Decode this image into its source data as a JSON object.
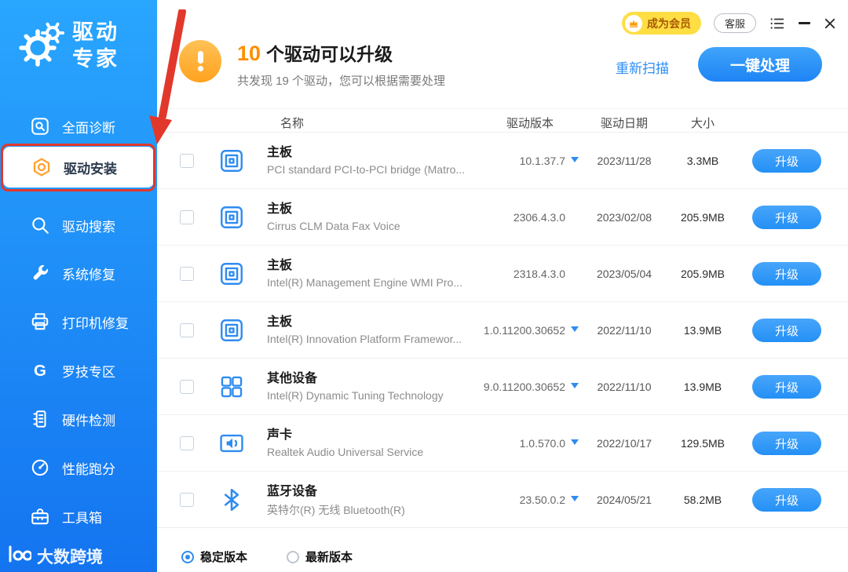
{
  "colors": {
    "accent_blue": "#2D9BF7",
    "sidebar_gradient_top": "#29A6FE",
    "sidebar_gradient_bottom": "#1474F0",
    "annotation_red": "#E2382C",
    "warning_orange": "#FFA21E",
    "member_yellow": "#FFDE43"
  },
  "window": {
    "member_label": "成为会员",
    "support_label": "客服"
  },
  "sidebar": {
    "logo_line1": "驱动",
    "logo_line2": "专家",
    "items": [
      {
        "label": "全面诊断",
        "active": false
      },
      {
        "label": "驱动安装",
        "active": true
      },
      {
        "label": "驱动搜索",
        "active": false
      },
      {
        "label": "系统修复",
        "active": false
      },
      {
        "label": "打印机修复",
        "active": false
      },
      {
        "label": "罗技专区",
        "active": false
      },
      {
        "label": "硬件检测",
        "active": false
      },
      {
        "label": "性能跑分",
        "active": false
      },
      {
        "label": "工具箱",
        "active": false
      }
    ],
    "watermark": "大数跨境"
  },
  "header": {
    "upgrade_count": "10",
    "title_suffix": "个驱动可以升级",
    "subtitle": "共发现 19 个驱动，您可以根据需要处理",
    "rescan_label": "重新扫描",
    "process_label": "一键处理"
  },
  "table": {
    "headers": [
      "名称",
      "驱动版本",
      "驱动日期",
      "大小"
    ],
    "rows": [
      {
        "category": "主板",
        "name": "PCI standard PCI-to-PCI bridge (Matro...",
        "version": "10.1.37.7",
        "dropdown": true,
        "date": "2023/11/28",
        "size": "3.3MB",
        "action": "升级"
      },
      {
        "category": "主板",
        "name": "Cirrus CLM Data Fax Voice",
        "version": "2306.4.3.0",
        "dropdown": false,
        "date": "2023/02/08",
        "size": "205.9MB",
        "action": "升级"
      },
      {
        "category": "主板",
        "name": "Intel(R) Management Engine WMI Pro...",
        "version": "2318.4.3.0",
        "dropdown": false,
        "date": "2023/05/04",
        "size": "205.9MB",
        "action": "升级"
      },
      {
        "category": "主板",
        "name": "Intel(R) Innovation Platform Framewor...",
        "version": "1.0.11200.30652",
        "dropdown": true,
        "date": "2022/11/10",
        "size": "13.9MB",
        "action": "升级"
      },
      {
        "category": "其他设备",
        "name": "Intel(R) Dynamic Tuning Technology",
        "version": "9.0.11200.30652",
        "dropdown": true,
        "date": "2022/11/10",
        "size": "13.9MB",
        "action": "升级"
      },
      {
        "category": "声卡",
        "name": "Realtek Audio Universal Service",
        "version": "1.0.570.0",
        "dropdown": true,
        "date": "2022/10/17",
        "size": "129.5MB",
        "action": "升级"
      },
      {
        "category": "蓝牙设备",
        "name": "英特尔(R) 无线 Bluetooth(R)",
        "version": "23.50.0.2",
        "dropdown": true,
        "date": "2024/05/21",
        "size": "58.2MB",
        "action": "升级"
      }
    ]
  },
  "footer": {
    "options": [
      {
        "label": "稳定版本",
        "selected": true
      },
      {
        "label": "最新版本",
        "selected": false
      }
    ]
  }
}
